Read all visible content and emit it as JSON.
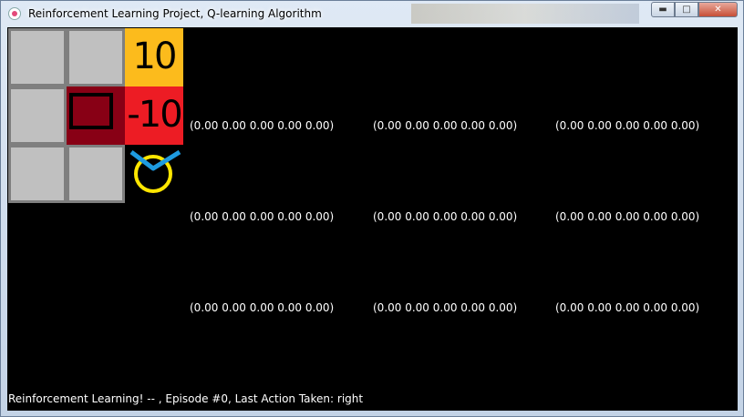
{
  "window": {
    "title": "Reinforcement Learning Project, Q-learning Algorithm",
    "minimize_icon": "minimize-icon",
    "maximize_icon": "maximize-icon",
    "close_icon": "close-icon"
  },
  "grid": {
    "rows": 3,
    "cols": 3,
    "goal_reward": "10",
    "penalty_reward": "-10",
    "colors": {
      "empty": "#c0c0c0",
      "goal": "#fcbb1c",
      "penalty": "#ed1c24",
      "obstacle": "#880015",
      "agent_ring": "#ffe600",
      "agent_check": "#1e9be0"
    },
    "agent_icon": "agent-smiley-icon"
  },
  "q_values": [
    [
      "(0.00 0.00 0.00 0.00 0.00)",
      "(0.00 0.00 0.00 0.00 0.00)",
      "(0.00 0.00 0.00 0.00 0.00)"
    ],
    [
      "(0.00 0.00 0.00 0.00 0.00)",
      "(0.00 0.00 0.00 0.00 0.00)",
      "(0.00 0.00 0.00 0.00 0.00)"
    ],
    [
      "(0.00 0.00 0.00 0.00 0.00)",
      "(0.00 0.00 0.00 0.00 0.00)",
      "(0.00 0.00 0.00 0.00 0.00)"
    ]
  ],
  "status": "Reinforcement Learning! -- , Episode #0, Last Action Taken: right"
}
